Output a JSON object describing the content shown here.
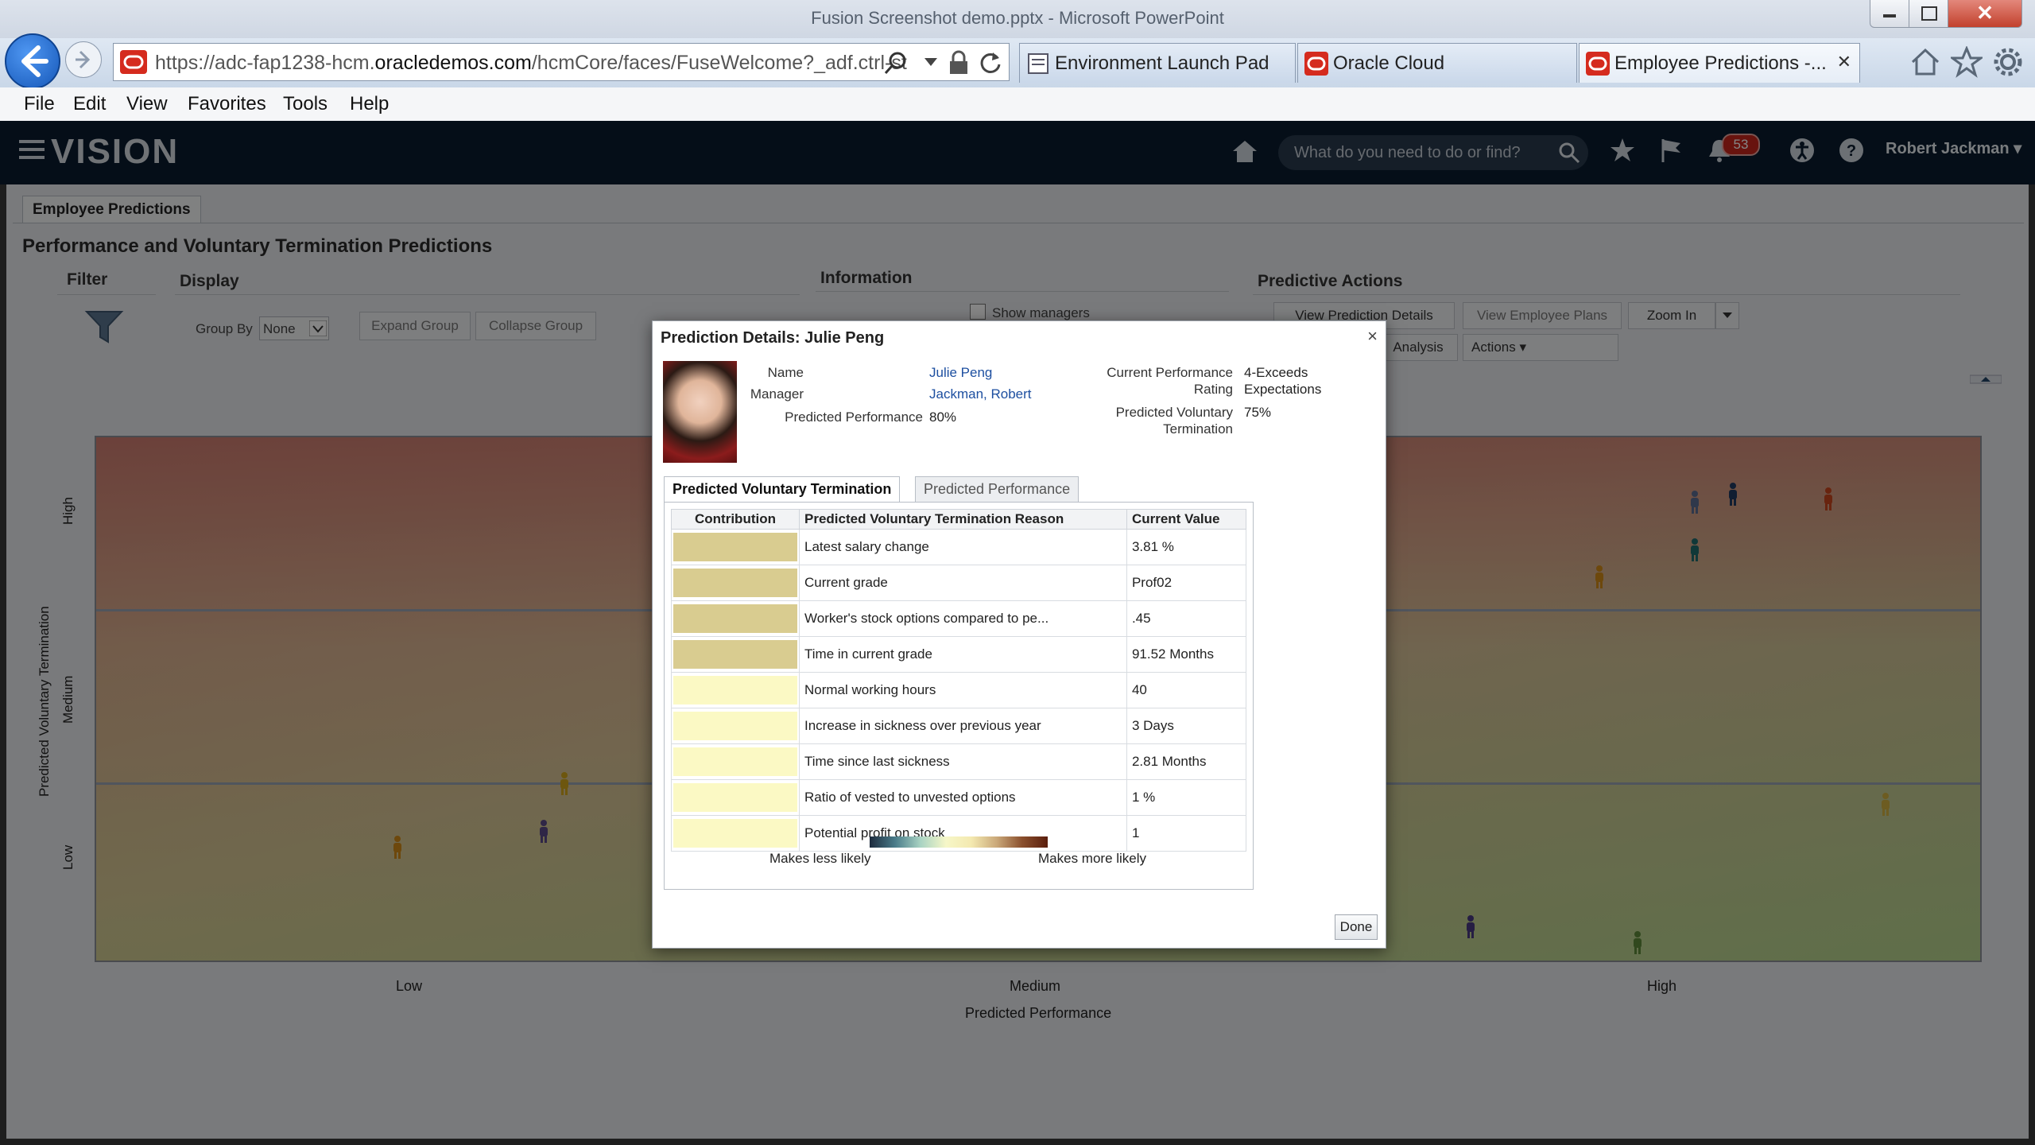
{
  "window": {
    "title": "Fusion Screenshot demo.pptx - Microsoft PowerPoint",
    "close_glyph": "✕"
  },
  "browser": {
    "url_prefix": "https://adc-fap1238-hcm.",
    "url_domain": "oracledemos.com",
    "url_path": "/hcmCore/faces/FuseWelcome?_adf.ctrl-st",
    "tabs": [
      {
        "label": "Environment Launch Pad",
        "icon": "page-icon"
      },
      {
        "label": "Oracle Cloud",
        "icon": "oracle-icon"
      },
      {
        "label": "Employee Predictions -...",
        "icon": "oracle-icon",
        "active": true
      }
    ],
    "tab_close_glyph": "✕"
  },
  "menu": [
    "File",
    "Edit",
    "View",
    "Favorites",
    "Tools",
    "Help"
  ],
  "app": {
    "logo": "VISION",
    "search_placeholder": "What do you need to do or find?",
    "notification_count": "53",
    "user_name": "Robert Jackman ▾"
  },
  "page": {
    "tab_label": "Employee Predictions",
    "title": "Performance and Voluntary Termination Predictions",
    "filter_heading": "Filter",
    "display_heading": "Display",
    "information_heading": "Information",
    "predictive_actions_heading": "Predictive Actions",
    "group_by_label": "Group By",
    "group_by_value": "None",
    "expand_group": "Expand Group",
    "collapse_group": "Collapse Group",
    "show_managers": "Show managers",
    "view_prediction_details": "View Prediction Details",
    "view_employee_plans": "View Employee Plans",
    "zoom_in": "Zoom In",
    "analysis": "Analysis",
    "actions": "Actions ▾"
  },
  "matrix": {
    "y_axis_title": "Predicted Voluntary Termination",
    "y_levels": [
      "High",
      "Medium",
      "Low"
    ],
    "x_levels": [
      "Low",
      "Medium",
      "High"
    ],
    "x_axis_title": "Predicted Performance",
    "colors": {
      "high_risk": "#c85a5a",
      "low_risk": "#a8cf86"
    }
  },
  "dialog": {
    "title": "Prediction Details: Julie Peng",
    "close_glyph": "×",
    "name_label": "Name",
    "name_value": "Julie Peng",
    "manager_label": "Manager",
    "manager_value": "Jackman, Robert",
    "pred_perf_label": "Predicted Performance",
    "pred_perf_value": "80%",
    "current_perf_label_1": "Current Performance",
    "current_perf_label_2": "Rating",
    "current_perf_value_1": "4-Exceeds",
    "current_perf_value_2": "Expectations",
    "pred_term_label_1": "Predicted Voluntary",
    "pred_term_label_2": "Termination",
    "pred_term_value": "75%",
    "tabs": [
      "Predicted Voluntary Termination",
      "Predicted Performance"
    ],
    "table": {
      "headers": [
        "Contribution",
        "Predicted Voluntary Termination Reason",
        "Current Value"
      ],
      "rows": [
        {
          "color": "#d9cc90",
          "reason": "Latest salary change",
          "value": "3.81 %"
        },
        {
          "color": "#d9cc90",
          "reason": "Current grade",
          "value": "Prof02"
        },
        {
          "color": "#d9cc90",
          "reason": "Worker's stock options compared to pe...",
          "value": ".45"
        },
        {
          "color": "#d9cc90",
          "reason": "Time in current grade",
          "value": "91.52 Months"
        },
        {
          "color": "#fbf9c4",
          "reason": "Normal working hours",
          "value": "40"
        },
        {
          "color": "#fbf9c4",
          "reason": "Increase in sickness over previous year",
          "value": "3 Days"
        },
        {
          "color": "#fbf9c4",
          "reason": "Time since last sickness",
          "value": "2.81 Months"
        },
        {
          "color": "#fbf9c4",
          "reason": "Ratio of vested to unvested options",
          "value": "1 %"
        },
        {
          "color": "#fbf9c4",
          "reason": "Potential profit on stock",
          "value": "1"
        }
      ]
    },
    "legend_less": "Makes less likely",
    "legend_more": "Makes more likely",
    "done": "Done"
  }
}
